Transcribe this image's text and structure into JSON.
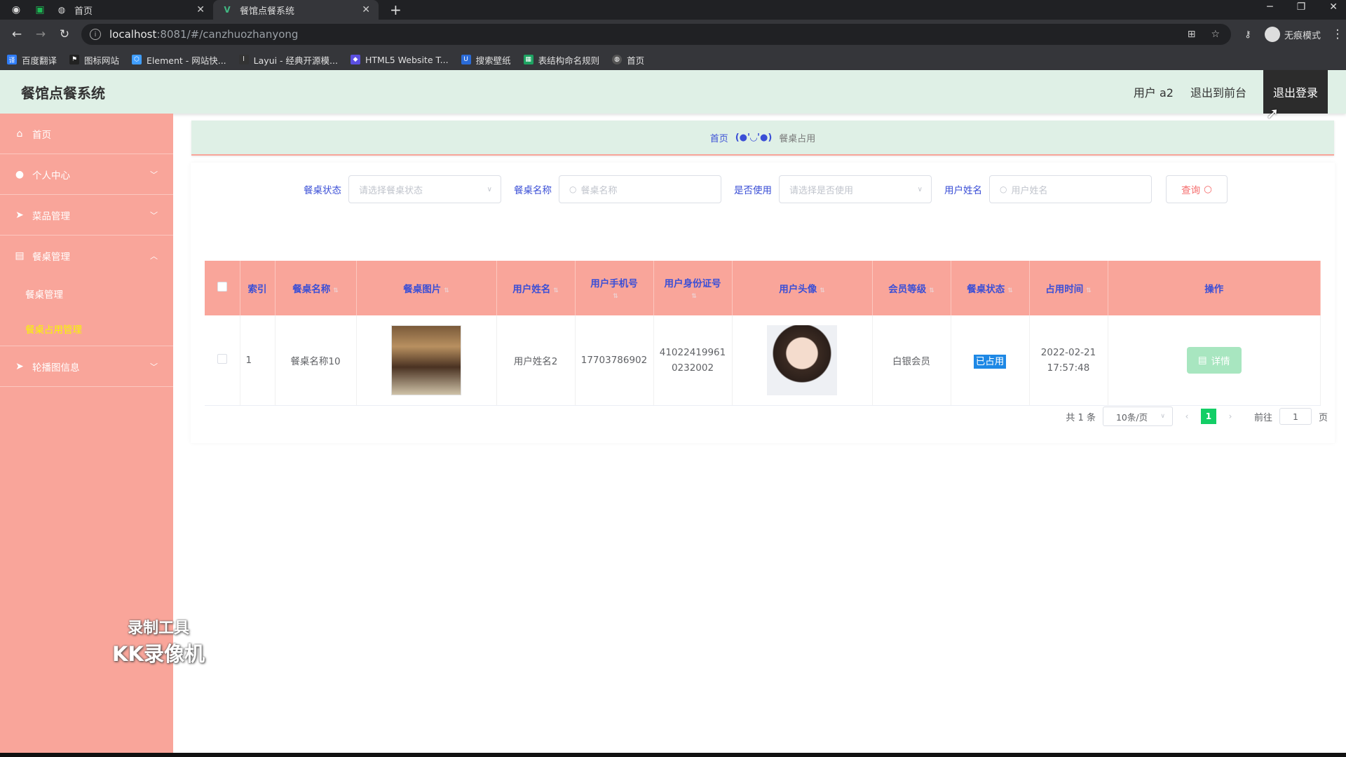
{
  "browser": {
    "tabs": [
      {
        "label": "首页",
        "active": false
      },
      {
        "label": "餐馆点餐系统",
        "active": true
      }
    ],
    "url_host": "localhost",
    "url_rest": ":8081/#/canzhuozhanyong",
    "profile_label": "无痕模式",
    "bookmarks": [
      "百度翻译",
      "图标网站",
      "Element - 网站快...",
      "Layui - 经典开源模...",
      "HTML5 Website T...",
      "搜索壁纸",
      "表结构命名规则",
      "首页"
    ]
  },
  "header": {
    "title": "餐馆点餐系统",
    "user": "用户 a2",
    "front": "退出到前台",
    "logout": "退出登录"
  },
  "sidebar": {
    "items": [
      {
        "label": "首页",
        "icon": "home-icon"
      },
      {
        "label": "个人中心",
        "icon": "user-icon"
      },
      {
        "label": "菜品管理",
        "icon": "send-icon"
      },
      {
        "label": "餐桌管理",
        "icon": "calendar-icon"
      },
      {
        "label": "轮播图信息",
        "icon": "send-icon"
      }
    ],
    "sub_items": [
      {
        "label": "餐桌管理",
        "active": false
      },
      {
        "label": "餐桌占用管理",
        "active": true
      }
    ]
  },
  "watermark": {
    "line1": "录制工具",
    "line2": "KK录像机"
  },
  "breadcrumb": {
    "home": "首页",
    "sep": "(●'◡'●)",
    "current": "餐桌占用"
  },
  "filters": {
    "status_label": "餐桌状态",
    "status_placeholder": "请选择餐桌状态",
    "name_label": "餐桌名称",
    "name_placeholder": "餐桌名称",
    "used_label": "是否使用",
    "used_placeholder": "请选择是否使用",
    "user_label": "用户姓名",
    "user_placeholder": "用户姓名",
    "query_label": "查询"
  },
  "table": {
    "headers": [
      "索引",
      "餐桌名称",
      "餐桌图片",
      "用户姓名",
      "用户手机号",
      "用户身份证号",
      "用户头像",
      "会员等级",
      "餐桌状态",
      "占用时间",
      "操作"
    ],
    "rows": [
      {
        "index": "1",
        "name": "餐桌名称10",
        "user": "用户姓名2",
        "phone": "17703786902",
        "idcard": "410224199610232002",
        "level": "白银会员",
        "status": "已占用",
        "date": "2022-02-21",
        "time": "17:57:48",
        "action": "详情"
      }
    ]
  },
  "pager": {
    "total": "共 1 条",
    "size": "10条/页",
    "page": "1",
    "goto": "前往",
    "goto_value": "1",
    "unit": "页"
  }
}
